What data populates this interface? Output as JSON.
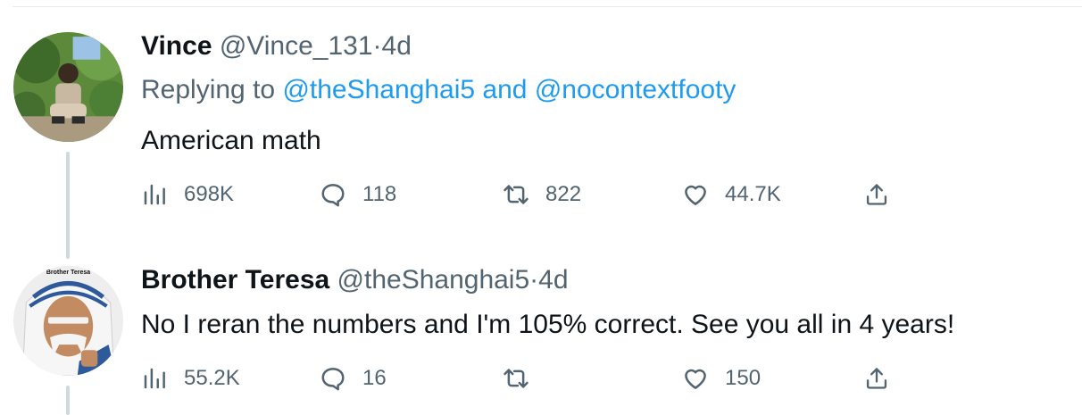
{
  "tweets": [
    {
      "name": "Vince",
      "handle": "@Vince_131",
      "separator": "·",
      "time": "4d",
      "replying_prefix": "Replying to",
      "replying_mention_1": "@theShanghai5",
      "replying_and": "and",
      "replying_mention_2": "@nocontextfooty",
      "text": "American math",
      "views": "698K",
      "replies": "118",
      "retweets": "822",
      "likes": "44.7K"
    },
    {
      "name": "Brother Teresa",
      "handle": "@theShanghai5",
      "separator": "·",
      "time": "4d",
      "avatar_caption": "Brother Teresa",
      "text": "No I reran the numbers and I'm 105% correct. See you all in 4 years!",
      "views": "55.2K",
      "replies": "16",
      "retweets": "",
      "likes": "150"
    }
  ],
  "icons": {
    "views": "bar-chart-icon",
    "reply": "speech-bubble-icon",
    "retweet": "retweet-icon",
    "like": "heart-icon",
    "share": "share-icon"
  },
  "colors": {
    "text": "#0f1419",
    "muted": "#536471",
    "link": "#1d9bf0",
    "thread_line": "#cfd9de"
  }
}
